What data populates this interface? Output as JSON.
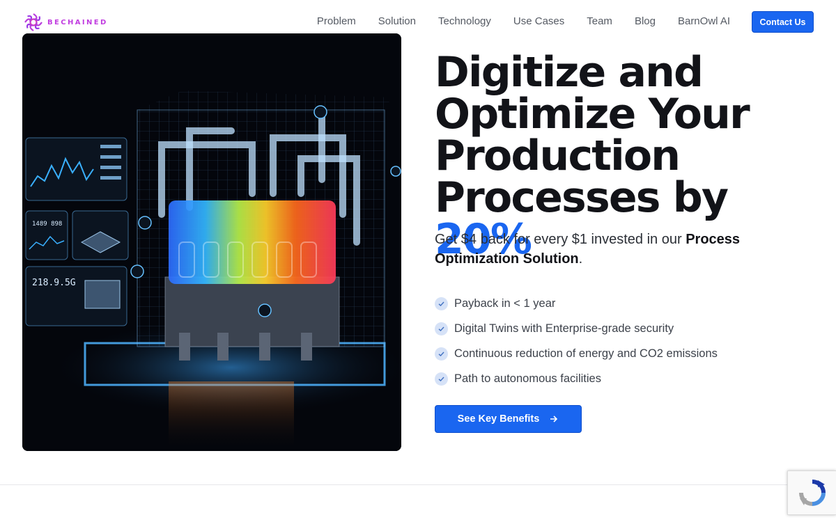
{
  "brand": {
    "name": "BECHAINED",
    "color": "#c13de0"
  },
  "nav": {
    "links": [
      "Problem",
      "Solution",
      "Technology",
      "Use Cases",
      "Team",
      "Blog",
      "BarnOwl AI"
    ],
    "contact_label": "Contact Us"
  },
  "hero": {
    "image_alt": "industrial-machine-digital-twin-illustration",
    "image_panels": {
      "panel2_value": "1489 898",
      "panel3_value": "218.9.5G"
    },
    "headline_part1": "Digitize and Optimize Your Production Processes by",
    "headline_highlight": "20%",
    "subhead_part1": "Get $4 back for every $1 invested in our",
    "subhead_bold": "Process Optimization Solution",
    "subhead_end": ".",
    "benefits": [
      "Payback in < 1 year",
      "Digital Twins with Enterprise-grade security",
      "Continuous reduction of energy and CO2 emissions",
      "Path to autonomous facilities"
    ],
    "cta_label": "See Key Benefits"
  },
  "colors": {
    "accent": "#1a66f0",
    "text": "#121318",
    "muted": "#555a63"
  },
  "icons": {
    "check": "check-icon",
    "arrow": "arrow-right-icon",
    "recaptcha": "recaptcha-icon"
  }
}
